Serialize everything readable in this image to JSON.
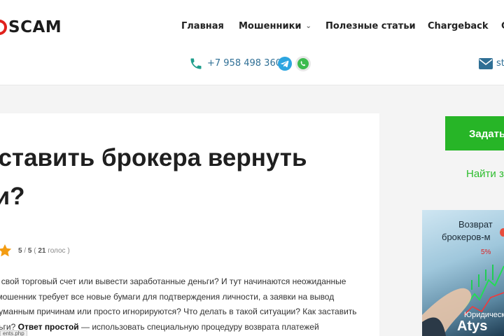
{
  "header": {
    "logo_text": "SCAM",
    "nav": [
      {
        "label": "Главная"
      },
      {
        "label": "Мошенники"
      },
      {
        "label": "Полезные статьи"
      },
      {
        "label": "Chargeback"
      },
      {
        "label": "C"
      }
    ],
    "phone": "+7 958 498 3602",
    "email_partial": "st"
  },
  "article": {
    "title_line1": "аставить брокера вернуть",
    "title_line2": "ги?",
    "rating": {
      "score": "5",
      "max": "5",
      "votes": "21",
      "votes_label": "голос"
    },
    "paragraph": {
      "line1": "ыть свой торговый счет или вывести заработанные деньги? И тут начинаются неожиданные",
      "line2": "ер-мошенник требует все новые бумаги для подтверждения личности, а заявки на вывод",
      "line3": "надуманным причинам или просто игнорируются? Что делать в такой ситуации? Как заставить",
      "line4_prefix": "деньги?",
      "line4_bold": "Ответ простой",
      "line4_suffix": "— использовать специальную процедуру возврата платежей"
    },
    "status_url": "ents.php"
  },
  "sidebar": {
    "button_label": "Задать",
    "link_label": "Найти з",
    "ad": {
      "line1": "Возврат",
      "line2": "брокеров-м",
      "percent": "5%",
      "line3": "Юридическ",
      "brand": "Atys"
    }
  },
  "colors": {
    "accent_green": "#27b527",
    "link_blue": "#2f6f95",
    "logo_red": "#e0211c",
    "star_orange": "#f39c12"
  }
}
